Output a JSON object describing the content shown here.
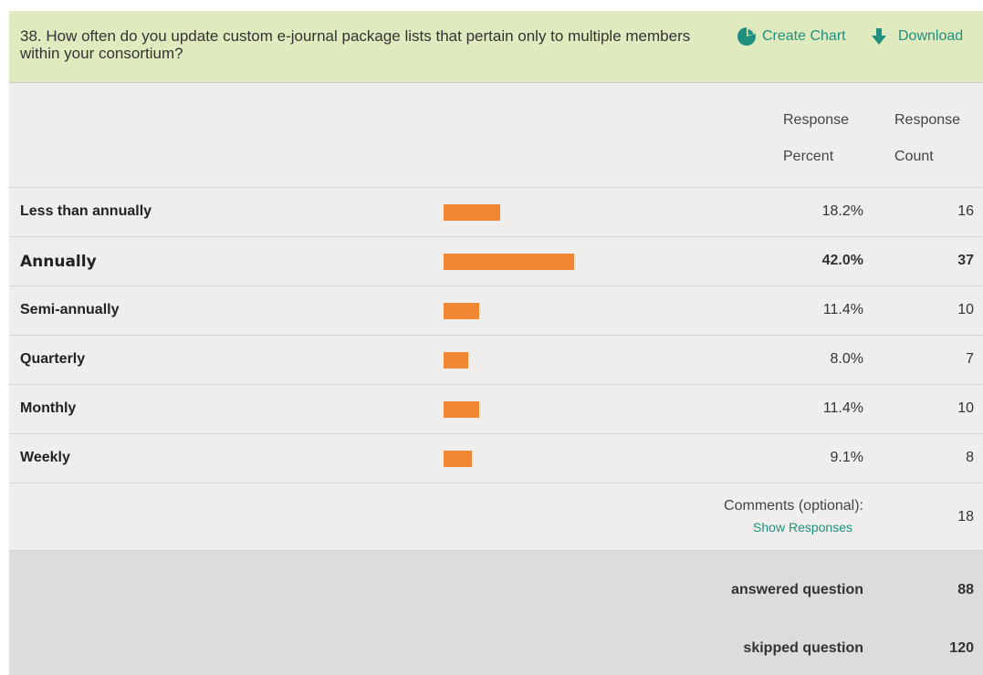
{
  "question": "38. How often do you update custom e-journal package lists that pertain only to multiple members within your consortium?",
  "actions": {
    "create_chart": "Create Chart",
    "download": "Download"
  },
  "colors": {
    "accent": "#1f8f7f",
    "bar": "#ef8733",
    "header_bg": "#dfebbe"
  },
  "columns": {
    "percent_line1": "Response",
    "percent_line2": "Percent",
    "count_line1": "Response",
    "count_line2": "Count"
  },
  "chart_data": {
    "type": "bar",
    "categories": [
      "Less than annually",
      "Annually",
      "Semi-annually",
      "Quarterly",
      "Monthly",
      "Weekly"
    ],
    "percent_labels": [
      "18.2%",
      "42.0%",
      "11.4%",
      "8.0%",
      "11.4%",
      "9.1%"
    ],
    "percents": [
      18.2,
      42.0,
      11.4,
      8.0,
      11.4,
      9.1
    ],
    "counts": [
      "16",
      "37",
      "10",
      "7",
      "10",
      "8"
    ],
    "highlight_index": 1,
    "xlim": [
      0,
      100
    ]
  },
  "comments": {
    "label": "Comments (optional):",
    "link": "Show Responses",
    "count": "18"
  },
  "summary": {
    "answered_label": "answered question",
    "answered_value": "88",
    "skipped_label": "skipped question",
    "skipped_value": "120"
  }
}
